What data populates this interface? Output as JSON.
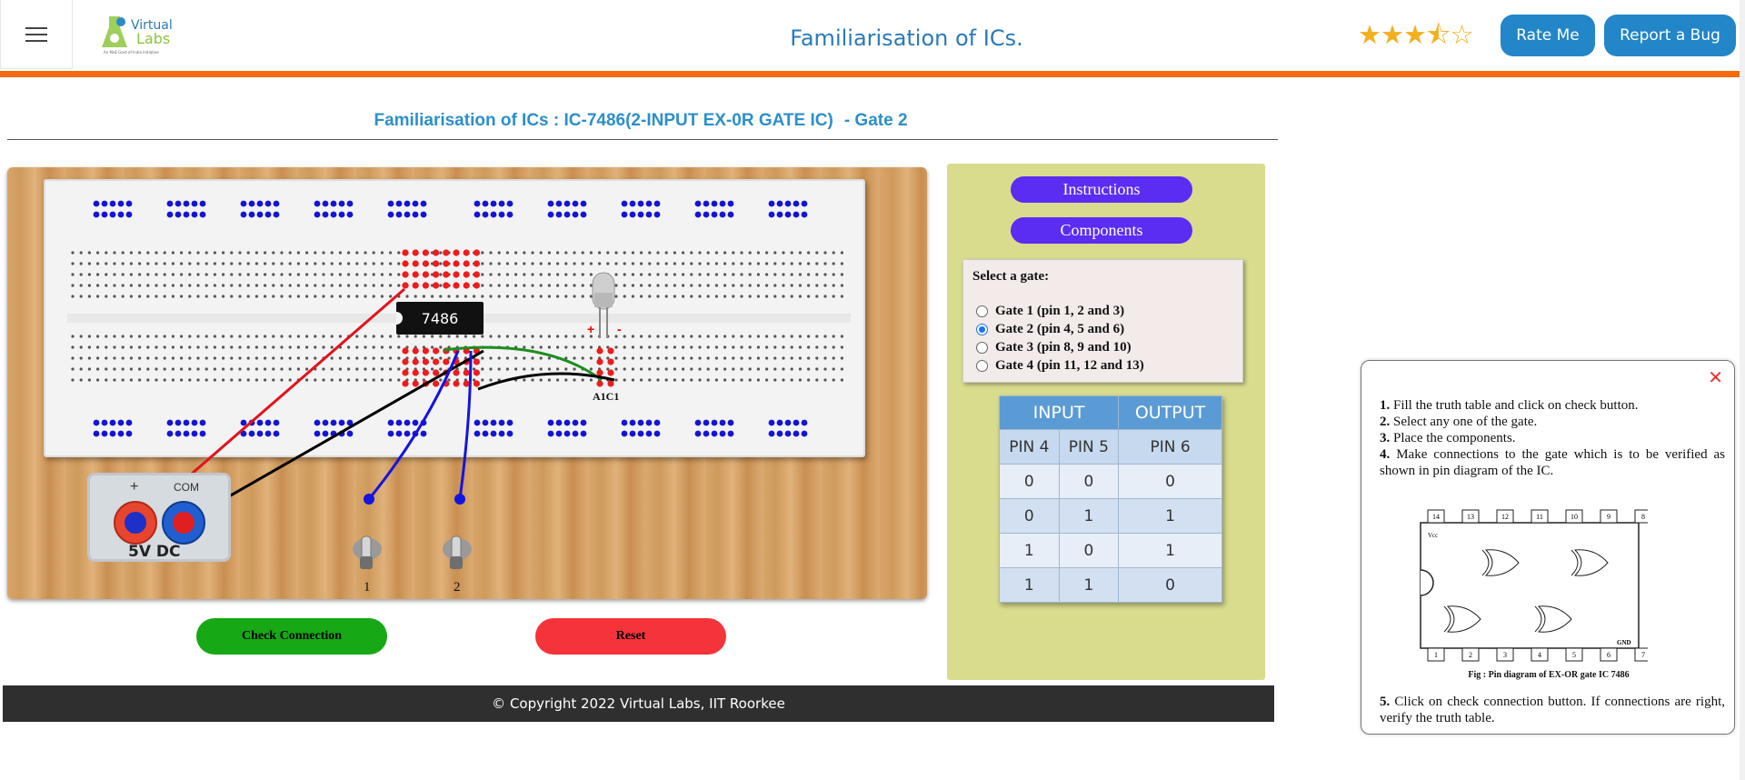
{
  "header": {
    "menu_icon": "hamburger-icon",
    "logo_text": "Virtual Labs",
    "logo_tagline": "An MoE Govt of India Initiative",
    "title": "Familiarisation of ICs.",
    "rating": 3.5,
    "rating_max": 5,
    "rate_label": "Rate Me",
    "bug_label": "Report a Bug",
    "accent": "#f46a0c",
    "brand": "#2286c8"
  },
  "experiment": {
    "title": "Familiarisation of ICs : IC-7486(2-INPUT EX-0R GATE IC)",
    "gate_label": "- Gate 2"
  },
  "workbench": {
    "ic_label": "7486",
    "led_label": "A1C1",
    "led_plus": "+",
    "led_minus": "-",
    "psu_plus": "+",
    "psu_com": "COM",
    "psu_label": "5V  DC",
    "switches": [
      "1",
      "2"
    ],
    "check_label": "Check Connection",
    "reset_label": "Reset"
  },
  "panel": {
    "instructions_label": "Instructions",
    "components_label": "Components",
    "select_label": "Select a gate:",
    "gates": [
      {
        "label": "Gate 1 (pin 1, 2 and 3)",
        "selected": false
      },
      {
        "label": "Gate 2 (pin 4, 5 and 6)",
        "selected": true
      },
      {
        "label": "Gate 3 (pin 8, 9 and 10)",
        "selected": false
      },
      {
        "label": "Gate 4 (pin 11, 12 and 13)",
        "selected": false
      }
    ],
    "table": {
      "input_header": "INPUT",
      "output_header": "OUTPUT",
      "columns": [
        "PIN 4",
        "PIN 5",
        "PIN 6"
      ],
      "rows": [
        [
          "0",
          "0",
          "0"
        ],
        [
          "0",
          "1",
          "1"
        ],
        [
          "1",
          "0",
          "1"
        ],
        [
          "1",
          "1",
          "0"
        ]
      ]
    }
  },
  "footer": {
    "text": "© Copyright 2022 Virtual Labs, IIT Roorkee"
  },
  "popup": {
    "close_icon": "close-icon",
    "steps": [
      {
        "num": "1.",
        "text": "Fill the truth table and click on check button."
      },
      {
        "num": "2.",
        "text": "Select any one of the gate."
      },
      {
        "num": "3.",
        "text": "Place the components."
      },
      {
        "num": "4.",
        "text": "Make connections to the gate which is to be verified as shown in pin diagram of the IC."
      }
    ],
    "step5_num": "5.",
    "step5_text": "Click on check connection button. If connections are right, verify the truth table.",
    "diagram_caption": "Fig : Pin diagram of EX-OR gate IC 7486",
    "diagram_top_pins": [
      "14",
      "13",
      "12",
      "11",
      "10",
      "9",
      "8"
    ],
    "diagram_bottom_pins": [
      "1",
      "2",
      "3",
      "4",
      "5",
      "6",
      "7"
    ],
    "diagram_vcc": "Vcc",
    "diagram_gnd": "GND"
  }
}
